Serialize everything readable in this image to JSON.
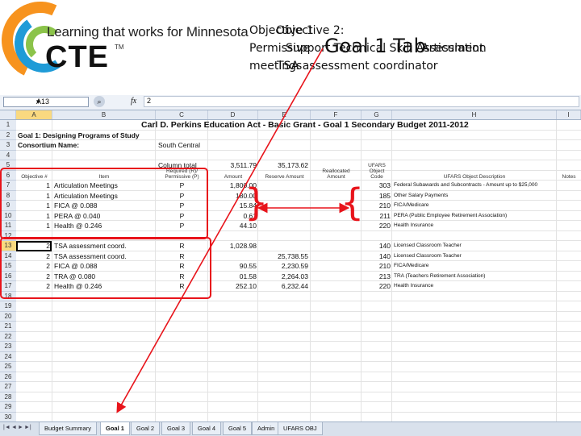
{
  "logo": {
    "tagline": "Learning that works for Minnesota",
    "wordmark": "CTE",
    "trademark": "TM"
  },
  "overlay": {
    "objective1": "Objective 1",
    "objective2": "Objective 2:",
    "goal_tab": "Goal 1 Tab",
    "permissive": "Permissive",
    "support": "Support Technical Skill Assessment",
    "articulation": "Articulation",
    "meetings": "meetings",
    "tsa_coord": "TSA assessment coordinator"
  },
  "formula_bar": {
    "name_box": "A13",
    "fx": "fx",
    "value": "2"
  },
  "columns": [
    "A",
    "B",
    "C",
    "D",
    "E",
    "F",
    "G",
    "H",
    "I"
  ],
  "rows": [
    "1",
    "2",
    "3",
    "4",
    "5",
    "6",
    "7",
    "8",
    "9",
    "10",
    "11",
    "12",
    "13",
    "14",
    "15",
    "16",
    "17",
    "18",
    "19",
    "20",
    "21",
    "22",
    "23",
    "24",
    "25",
    "26",
    "27",
    "28",
    "29",
    "30"
  ],
  "sheet": {
    "title": "Carl D. Perkins Education Act - Basic Grant - Goal 1 Secondary Budget  2011-2012",
    "goal": "Goal 1: Designing Programs of Study",
    "consortium_label": "Consortium Name:",
    "consortium_value": "South Central",
    "column_total_label": "Column total",
    "column_total_d": "3,511.79",
    "column_total_e": "35,173.62",
    "headers": {
      "objective": "Objective #",
      "item": "Item",
      "req": "Required (R)/\nPermissive (P)",
      "amount": "Amount",
      "reserve": "Reserve Amount",
      "realloc": "Reallocated\nAmount",
      "ufars": "UFARS\nObject\nCode",
      "desc": "UFARS Object Description",
      "notes": "Notes"
    },
    "data_rows": [
      {
        "row": "7",
        "obj": "1",
        "item": "Articulation Meetings",
        "rp": "P",
        "amt": "1,800.00",
        "res": "",
        "code": "303",
        "desc": "Federal Subawards and Subcontracts - Amount up to $25,000"
      },
      {
        "row": "8",
        "obj": "1",
        "item": "Articulation Meetings",
        "rp": "P",
        "amt": "180.00",
        "res": "",
        "code": "185",
        "desc": "Other Salary Payments"
      },
      {
        "row": "9",
        "obj": "1",
        "item": "FICA @ 0.088",
        "rp": "P",
        "amt": "15.84",
        "res": "",
        "code": "210",
        "desc": "FICA/Medicare"
      },
      {
        "row": "10",
        "obj": "1",
        "item": "PERA @ 0.040",
        "rp": "P",
        "amt": "0.61",
        "res": "",
        "code": "211",
        "desc": "PERA (Public Employee Retirement Association)"
      },
      {
        "row": "11",
        "obj": "1",
        "item": "Health @ 0.246",
        "rp": "P",
        "amt": "44.10",
        "res": "",
        "code": "220",
        "desc": "Health Insurance"
      },
      {
        "row": "13",
        "obj": "2",
        "item": "TSA assessment coord.",
        "rp": "R",
        "amt": "1,028.98",
        "res": "",
        "code": "140",
        "desc": "Licensed Classroom Teacher"
      },
      {
        "row": "14",
        "obj": "2",
        "item": "TSA assessment coord.",
        "rp": "R",
        "amt": "",
        "res": "25,738.55",
        "code": "140",
        "desc": "Licensed Classroom Teacher"
      },
      {
        "row": "15",
        "obj": "2",
        "item": "FICA @ 0.088",
        "rp": "R",
        "amt": "90.55",
        "res": "2,230.59",
        "code": "210",
        "desc": "FICA/Medicare"
      },
      {
        "row": "16",
        "obj": "2",
        "item": "TRA @ 0.080",
        "rp": "R",
        "amt": "01.58",
        "res": "2,264.03",
        "code": "213",
        "desc": "TRA (Teachers Retirement Association)"
      },
      {
        "row": "17",
        "obj": "2",
        "item": "Health @ 0.246",
        "rp": "R",
        "amt": "252.10",
        "res": "6,232.44",
        "code": "220",
        "desc": "Health Insurance"
      }
    ]
  },
  "tabs": [
    "Budget Summary",
    "Goal 1",
    "Goal 2",
    "Goal 3",
    "Goal 4",
    "Goal 5",
    "Admin",
    "UFARS OBJ"
  ],
  "active_tab": "Goal 1",
  "tab_nav": [
    "|◄",
    "◄",
    "►",
    "►|"
  ],
  "colors": {
    "annotation": "#e8141b",
    "header_bg": "#e4eaf3",
    "selected_header": "#f9d980"
  }
}
